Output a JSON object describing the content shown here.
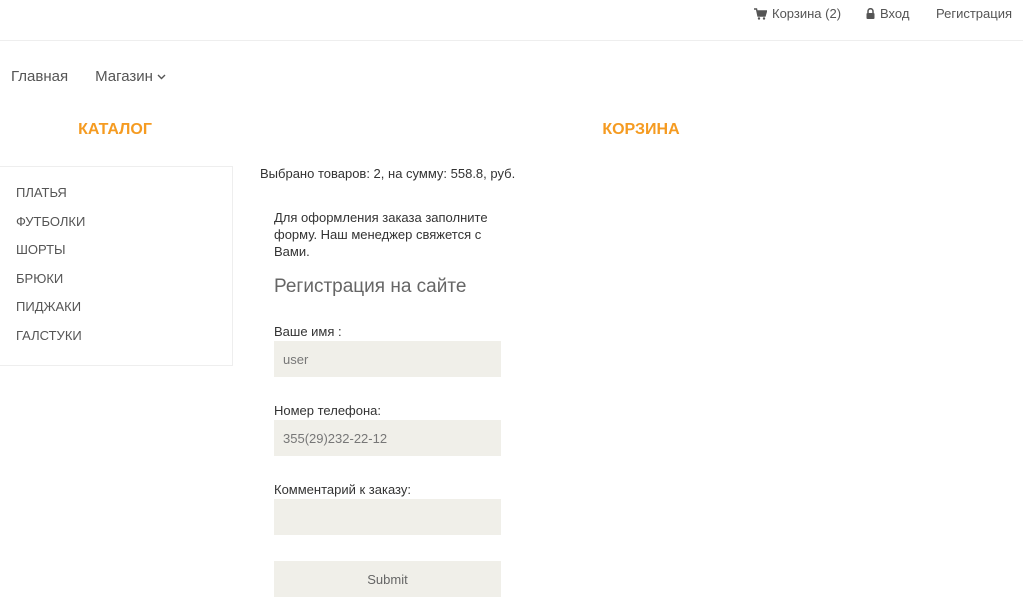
{
  "topbar": {
    "cart_label": "Корзина (2)",
    "login_label": "Вход",
    "register_label": "Регистрация"
  },
  "nav": {
    "home_label": "Главная",
    "shop_label": "Магазин"
  },
  "catalog": {
    "title": "КАТАЛОГ",
    "items": [
      "ПЛАТЬЯ",
      "ФУТБОЛКИ",
      "ШОРТЫ",
      "БРЮКИ",
      "ПИДЖАКИ",
      "ГАЛСТУКИ"
    ]
  },
  "cart": {
    "title": "КОРЗИНА",
    "summary": "Выбрано товаров: 2, на сумму: 558.8, руб.",
    "intro": "Для оформления заказа заполните форму. Наш менеджер свяжется с Вами.",
    "form": {
      "title": "Регистрация на сайте",
      "name_label": "Ваше имя :",
      "name_value": "user",
      "phone_label": "Номер телефона:",
      "phone_value": "355(29)232-22-12",
      "comment_label": "Комментарий к заказу:",
      "comment_value": "",
      "submit_label": "Submit"
    }
  },
  "colors": {
    "accent": "#f59b21",
    "field_bg": "#f0efe9"
  },
  "icons": {
    "cart": "cart-icon",
    "login": "lock-icon",
    "shop_dropdown": "chevron-down-icon"
  }
}
